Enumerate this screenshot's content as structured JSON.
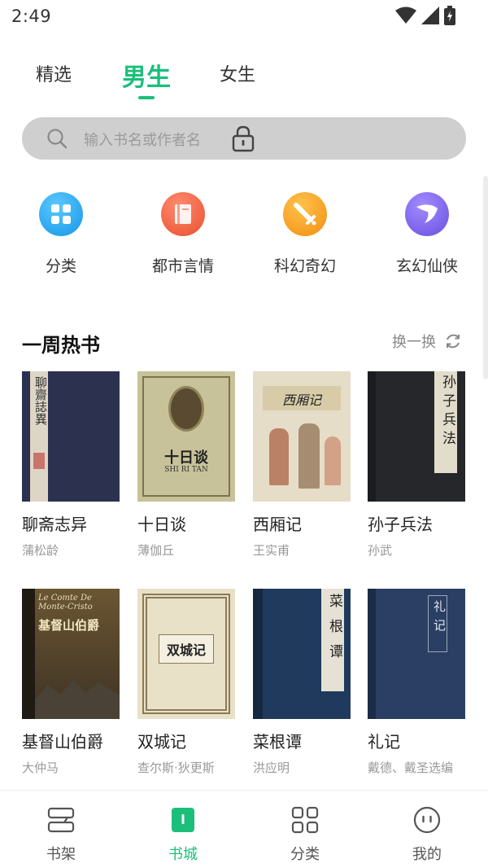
{
  "status": {
    "time": "2:49"
  },
  "top_tabs": [
    {
      "label": "精选",
      "active": false
    },
    {
      "label": "男生",
      "active": true
    },
    {
      "label": "女生",
      "active": false
    }
  ],
  "search": {
    "placeholder": "输入书名或作者名"
  },
  "categories": [
    {
      "label": "分类",
      "icon": "grid-icon",
      "color": "#2aa7f0"
    },
    {
      "label": "都市言情",
      "icon": "book-icon",
      "color": "#f2644a"
    },
    {
      "label": "科幻奇幻",
      "icon": "sword-icon",
      "color": "#f7a21b"
    },
    {
      "label": "玄幻仙侠",
      "icon": "wing-icon",
      "color": "#7b63e8"
    }
  ],
  "section": {
    "title": "一周热书",
    "refresh_label": "换一换"
  },
  "books": [
    {
      "title": "聊斋志异",
      "author": "蒲松龄",
      "cover_text": "聊齋誌異"
    },
    {
      "title": "十日谈",
      "author": "薄伽丘",
      "cover_text": "十日谈",
      "cover_subtext": "SHI RI TAN"
    },
    {
      "title": "西厢记",
      "author": "王实甫",
      "cover_text": "西厢记"
    },
    {
      "title": "孙子兵法",
      "author": "孙武",
      "cover_text": "孙子兵法"
    },
    {
      "title": "基督山伯爵",
      "author": "大仲马",
      "cover_text": "基督山伯爵",
      "cover_subtext": "Le Comte De Monte-Cristo"
    },
    {
      "title": "双城记",
      "author": "查尔斯·狄更斯",
      "cover_text": "双城记"
    },
    {
      "title": "菜根谭",
      "author": "洪应明",
      "cover_text": "菜根谭"
    },
    {
      "title": "礼记",
      "author": "戴德、戴圣选编",
      "cover_text": "礼记"
    }
  ],
  "bottom_nav": [
    {
      "label": "书架",
      "icon": "bookshelf-icon",
      "active": false
    },
    {
      "label": "书城",
      "icon": "bookstore-icon",
      "active": true
    },
    {
      "label": "分类",
      "icon": "category-grid-icon",
      "active": false
    },
    {
      "label": "我的",
      "icon": "profile-icon",
      "active": false
    }
  ],
  "colors": {
    "accent": "#1bbf7a",
    "search_bg": "#cfcfcf"
  }
}
